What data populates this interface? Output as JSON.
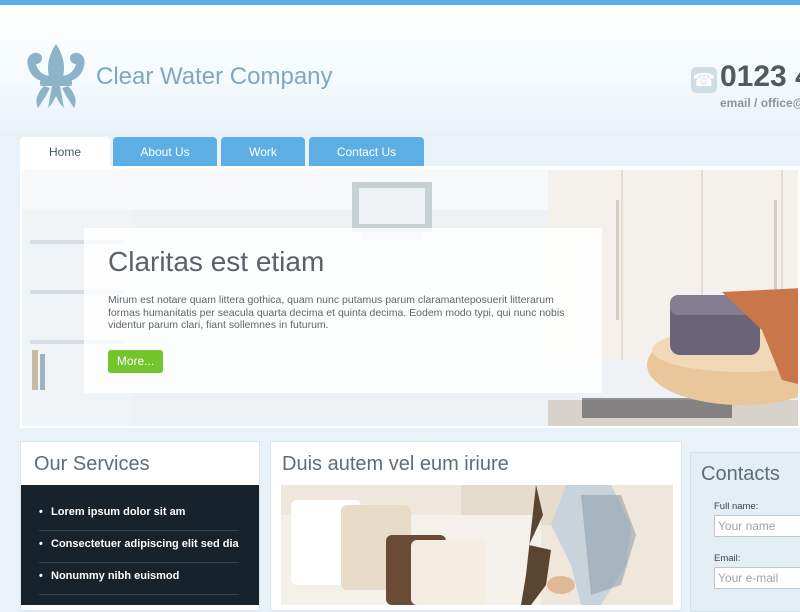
{
  "header": {
    "company_name": "Clear Water Company",
    "phone": "0123 4",
    "email": "email / office@"
  },
  "nav": {
    "tabs": [
      {
        "label": "Home",
        "active": true
      },
      {
        "label": "About Us",
        "active": false
      },
      {
        "label": "Work",
        "active": false
      },
      {
        "label": "Contact Us",
        "active": false
      }
    ]
  },
  "banner": {
    "title": "Claritas est etiam",
    "text": "Mirum est notare quam littera gothica, quam nunc putamus parum claramanteposuerit litterarum formas humanitatis per seacula quarta decima et quinta decima. Eodem modo typi, qui nunc nobis videntur parum clari, fiant sollemnes in futurum.",
    "button_label": "More..."
  },
  "services": {
    "title": "Our Services",
    "items": [
      "Lorem ipsum dolor sit am",
      "Consectetuer adipiscing elit sed dia",
      "Nonummy nibh euismod"
    ]
  },
  "middle": {
    "title": "Duis autem vel eum iriure"
  },
  "contacts": {
    "title": "Contacts",
    "fullname_label": "Full name:",
    "fullname_placeholder": "Your name",
    "email_label": "Email:",
    "email_placeholder": "Your e-mail"
  },
  "colors": {
    "accent_blue": "#5eaee6",
    "button_green": "#72c52c",
    "logo_blue": "#7fa8bf",
    "services_dark": "#16222c"
  },
  "icons": {
    "logo": "fleur-de-lis-icon",
    "phone": "telephone-icon"
  }
}
